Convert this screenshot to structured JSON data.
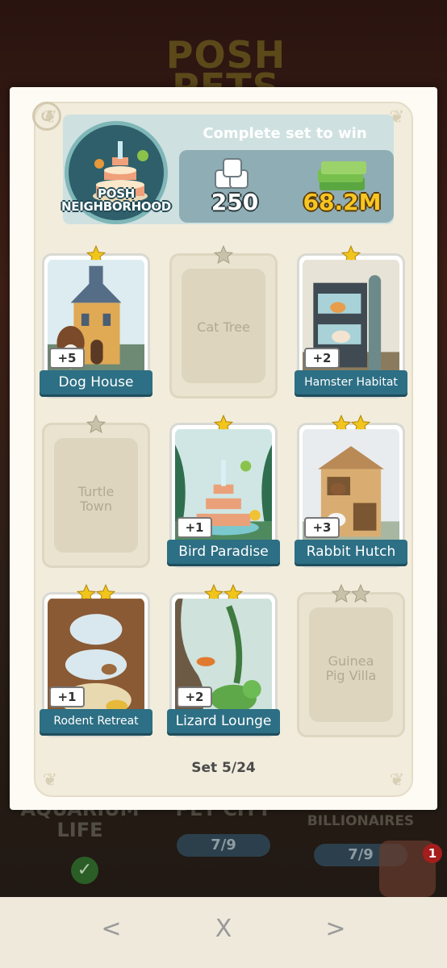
{
  "background": {
    "logo_text": "POSH PETS",
    "sets": [
      {
        "name": "AQUARIUM LIFE",
        "progress": ""
      },
      {
        "name": "PET CITY",
        "progress": "7/9"
      },
      {
        "name": "COLD-BLOODED BILLIONAIRES",
        "progress": "7/9"
      }
    ],
    "notification_count": "1"
  },
  "album": {
    "set_name": "POSH NEIGHBORHOOD",
    "complete_label": "Complete set to win",
    "reward_dice": "250",
    "reward_cash": "68.2M",
    "set_count": "Set 5/24",
    "cards": [
      {
        "name": "Dog House",
        "owned": true,
        "stars": 1,
        "plus": "+5"
      },
      {
        "name": "Cat Tree",
        "owned": false,
        "stars": 1,
        "plus": ""
      },
      {
        "name": "Hamster Habitat",
        "owned": true,
        "stars": 1,
        "plus": "+2"
      },
      {
        "name": "Turtle Town",
        "owned": false,
        "stars": 1,
        "plus": ""
      },
      {
        "name": "Bird Paradise",
        "owned": true,
        "stars": 1,
        "plus": "+1"
      },
      {
        "name": "Rabbit Hutch",
        "owned": true,
        "stars": 2,
        "plus": "+3"
      },
      {
        "name": "Rodent Retreat",
        "owned": true,
        "stars": 2,
        "plus": "+1"
      },
      {
        "name": "Lizard Lounge",
        "owned": true,
        "stars": 2,
        "plus": "+2"
      },
      {
        "name": "Guinea Pig Villa",
        "owned": false,
        "stars": 2,
        "plus": ""
      }
    ]
  },
  "nav": {
    "prev": "<",
    "close": "X",
    "next": ">"
  },
  "colors": {
    "label_blue": "#2d6f84",
    "star_gold": "#f2c51c",
    "star_gray": "#c9c2ab",
    "cash_yellow": "#f7c623"
  }
}
